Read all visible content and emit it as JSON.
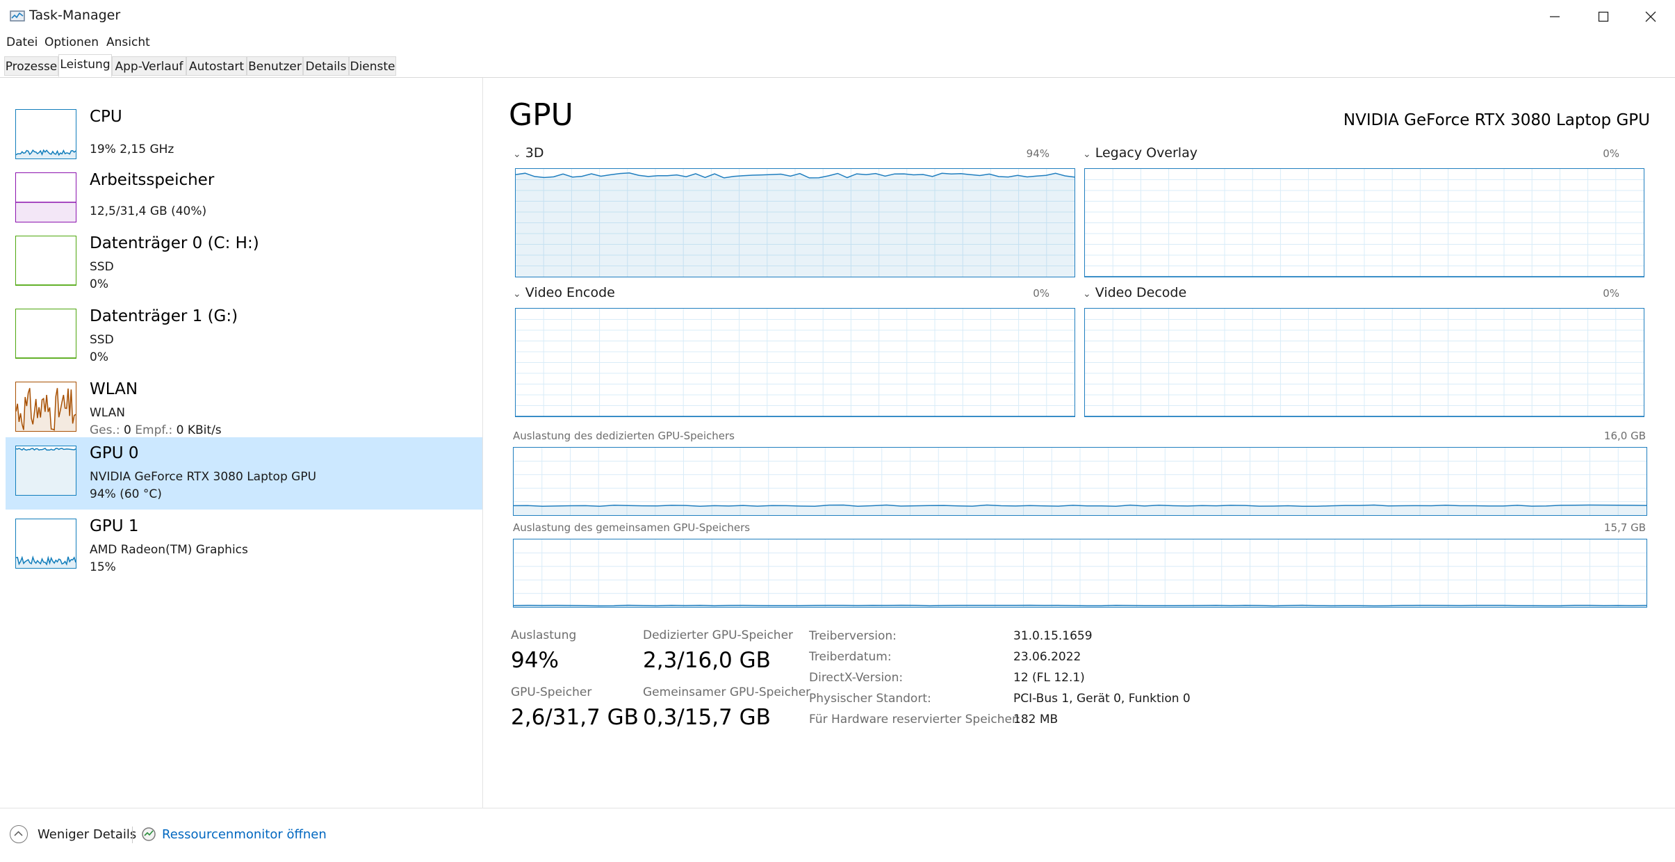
{
  "window": {
    "title": "Task-Manager"
  },
  "menu": [
    "Datei",
    "Optionen",
    "Ansicht"
  ],
  "tabs": [
    "Prozesse",
    "Leistung",
    "App-Verlauf",
    "Autostart",
    "Benutzer",
    "Details",
    "Dienste"
  ],
  "active_tab": "Leistung",
  "sidebar": {
    "items": [
      {
        "title": "CPU",
        "line1": "19%  2,15 GHz",
        "color": "#117dbb"
      },
      {
        "title": "Arbeitsspeicher",
        "line1": "12,5/31,4 GB (40%)",
        "usage": 0.4,
        "color": "#8b12ae"
      },
      {
        "title": "Datenträger 0 (C: H:)",
        "line1": "SSD",
        "line2": "0%",
        "color": "#4da60c"
      },
      {
        "title": "Datenträger 1 (G:)",
        "line1": "SSD",
        "line2": "0%",
        "color": "#4da60c"
      },
      {
        "title": "WLAN",
        "line1": "WLAN",
        "send_label": "Ges.:",
        "send_val": "0",
        "recv_label": "Empf.:",
        "recv_val": "0 KBit/s",
        "color": "#a74f01"
      },
      {
        "title": "GPU 0",
        "line1": "NVIDIA GeForce RTX 3080 Laptop GPU",
        "line2": "94%  (60 °C)",
        "color": "#117dbb"
      },
      {
        "title": "GPU 1",
        "line1": "AMD Radeon(TM) Graphics",
        "line2": "15%",
        "color": "#117dbb"
      }
    ]
  },
  "gpu": {
    "heading": "GPU",
    "model": "NVIDIA GeForce RTX 3080 Laptop GPU",
    "engines": [
      {
        "name": "3D",
        "pct": "94%",
        "usage": 0.94
      },
      {
        "name": "Legacy Overlay",
        "pct": "0%",
        "usage": 0
      },
      {
        "name": "Video Encode",
        "pct": "0%",
        "usage": 0
      },
      {
        "name": "Video Decode",
        "pct": "0%",
        "usage": 0
      }
    ],
    "dedicated_mem": {
      "label": "Auslastung des dedizierten GPU-Speichers",
      "max": "16,0 GB",
      "usage": 0.14
    },
    "shared_mem": {
      "label": "Auslastung des gemeinsamen GPU-Speichers",
      "max": "15,7 GB",
      "usage": 0.02
    },
    "stats": {
      "utilization": {
        "label": "Auslastung",
        "value": "94%"
      },
      "dedicated": {
        "label": "Dedizierter GPU-Speicher",
        "value": "2,3/16,0 GB"
      },
      "gpu_memory": {
        "label": "GPU-Speicher",
        "value": "2,6/31,7 GB"
      },
      "shared": {
        "label": "Gemeinsamer GPU-Speicher",
        "value": "0,3/15,7 GB"
      }
    },
    "info": [
      {
        "key": "Treiberversion:",
        "value": "31.0.15.1659"
      },
      {
        "key": "Treiberdatum:",
        "value": "23.06.2022"
      },
      {
        "key": "DirectX-Version:",
        "value": "12 (FL 12.1)"
      },
      {
        "key": "Physischer Standort:",
        "value": "PCI-Bus 1, Gerät 0, Funktion 0"
      },
      {
        "key": "Für Hardware reservierter Speicher:",
        "value": "182 MB"
      }
    ]
  },
  "footer": {
    "fewer_details": "Weniger Details",
    "resource_monitor": "Ressourcenmonitor öffnen"
  },
  "colors": {
    "accent": "#1f7ebf",
    "selected": "#cce8ff",
    "link": "#0067c0"
  }
}
